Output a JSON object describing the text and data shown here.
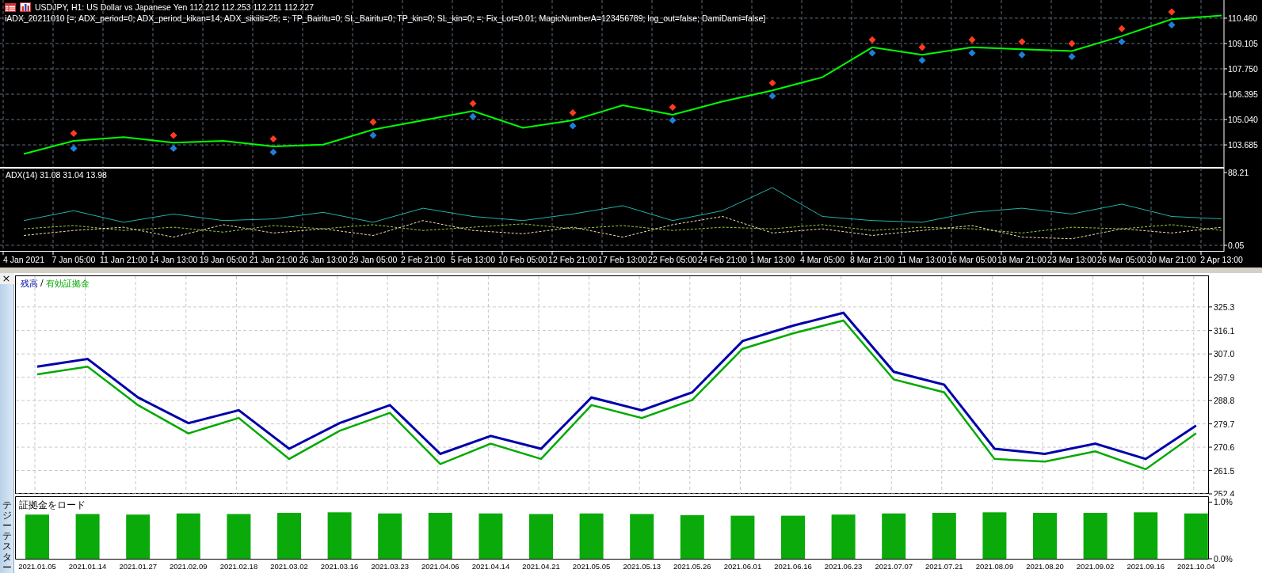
{
  "price_chart": {
    "symbol_line": "USDJPY, H1:  US Dollar vs Japanese Yen  112.212 112.253 112.211 112.227",
    "indicator_line": "iADX_20211010 [=; ADX_period=0; ADX_period_kikan=14; ADX_sikiiti=25; =; TP_Bairitu=0; SL_Bairitu=0; TP_kin=0; SL_kin=0; =; Fix_Lot=0.01; MagicNumberA=123456789; log_out=false; DamiDami=false]",
    "chart_data": {
      "type": "line",
      "grid": true,
      "categories": [
        null,
        null,
        null,
        null,
        null,
        null,
        null,
        null,
        null,
        null,
        null,
        null,
        null,
        null,
        null,
        null,
        null,
        null,
        null,
        null,
        null,
        null,
        null,
        null,
        null
      ],
      "series": [
        {
          "type": "line",
          "color": "#00ff00",
          "values": [
            103.2,
            103.9,
            104.1,
            103.8,
            103.9,
            103.6,
            103.7,
            104.5,
            105.0,
            105.5,
            104.6,
            105.0,
            105.8,
            105.3,
            106.0,
            106.6,
            107.3,
            108.9,
            108.5,
            108.9,
            108.8,
            108.7,
            109.5,
            110.4,
            110.6
          ]
        },
        {
          "type": "scatter",
          "color": "#ff3b1f",
          "values": [
            null,
            104.3,
            null,
            104.2,
            null,
            104.0,
            null,
            104.9,
            null,
            105.9,
            null,
            105.4,
            null,
            105.7,
            null,
            107.0,
            null,
            109.3,
            108.9,
            109.3,
            109.2,
            109.1,
            109.9,
            110.8,
            null
          ]
        },
        {
          "type": "scatter",
          "color": "#1e7fd8",
          "values": [
            null,
            103.5,
            null,
            103.5,
            null,
            103.3,
            null,
            104.2,
            null,
            105.2,
            null,
            104.7,
            null,
            105.0,
            null,
            106.3,
            null,
            108.6,
            108.2,
            108.6,
            108.5,
            108.4,
            109.2,
            110.1,
            null
          ]
        }
      ],
      "ylim": [
        102.46,
        111.43
      ],
      "yticks": [
        {
          "value": 110.46,
          "label": "110.460"
        },
        {
          "value": 109.105,
          "label": "109.105"
        },
        {
          "value": 107.75,
          "label": "107.750"
        },
        {
          "value": 106.395,
          "label": "106.395"
        },
        {
          "value": 105.04,
          "label": "105.040"
        },
        {
          "value": 103.685,
          "label": "103.685"
        }
      ]
    }
  },
  "adx_chart": {
    "label": "ADX(14) 31.08 31.04 13.98",
    "chart_data": {
      "type": "line",
      "grid": true,
      "categories": [
        "4 Jan 2021",
        "7 Jan 05:00",
        "11 Jan 21:00",
        "14 Jan 13:00",
        "19 Jan 05:00",
        "21 Jan 21:00",
        "26 Jan 13:00",
        "29 Jan 05:00",
        "2 Feb 21:00",
        "5 Feb 13:00",
        "10 Feb 05:00",
        "12 Feb 21:00",
        "17 Feb 13:00",
        "22 Feb 05:00",
        "24 Feb 21:00",
        "1 Mar 13:00",
        "4 Mar 05:00",
        "8 Mar 21:00",
        "11 Mar 13:00",
        "16 Mar 05:00",
        "18 Mar 21:00",
        "23 Mar 13:00",
        "26 Mar 05:00",
        "30 Mar 21:00",
        "2 Apr 13:00"
      ],
      "ylim": [
        0,
        88.21
      ],
      "yticks": [
        {
          "value": 88.21,
          "label": "88.21"
        },
        {
          "value": 0.05,
          "label": "0.05"
        }
      ],
      "series": [
        {
          "color": "#20b2aa",
          "line_style": "solid",
          "values": [
            30,
            42,
            28,
            38,
            30,
            32,
            40,
            28,
            45,
            35,
            30,
            38,
            48,
            30,
            42,
            70,
            35,
            30,
            28,
            40,
            45,
            38,
            50,
            35,
            32
          ]
        },
        {
          "color": "#9acd32",
          "line_style": "dashed",
          "values": [
            20,
            24,
            18,
            22,
            16,
            24,
            20,
            25,
            18,
            22,
            26,
            20,
            24,
            18,
            22,
            20,
            25,
            18,
            22,
            20,
            15,
            22,
            20,
            25,
            18
          ]
        },
        {
          "color": "#f5deb3",
          "line_style": "dashed",
          "values": [
            12,
            18,
            22,
            10,
            25,
            15,
            20,
            12,
            30,
            18,
            14,
            22,
            10,
            25,
            35,
            15,
            20,
            12,
            18,
            24,
            10,
            8,
            20,
            15,
            22
          ]
        }
      ]
    }
  },
  "tester": {
    "close_button": "×",
    "tab_label": "テジーテスター",
    "equity_chart": {
      "legend_separator": "/",
      "chart_data": {
        "type": "line",
        "grid": true,
        "categories": [
          null,
          null,
          null,
          null,
          null,
          null,
          null,
          null,
          null,
          null,
          null,
          null,
          null,
          null,
          null,
          null,
          null,
          null,
          null,
          null,
          null,
          null,
          null,
          null
        ],
        "series": [
          {
            "name": "残高",
            "color": "#0000aa",
            "values": [
              302,
              305,
              290,
              280,
              285,
              270,
              280,
              287,
              268,
              275,
              270,
              290,
              285,
              292,
              312,
              318,
              323,
              300,
              295,
              270,
              268,
              272,
              266,
              279
            ]
          },
          {
            "name": "有効証拠金",
            "color": "#00aa00",
            "values": [
              299,
              302,
              287,
              276,
              282,
              266,
              277,
              284,
              264,
              272,
              266,
              287,
              282,
              289,
              309,
              315,
              320,
              297,
              292,
              266,
              265,
              269,
              262,
              276
            ]
          }
        ],
        "ylim": [
          252.4,
          337.3
        ],
        "yticks": [
          {
            "value": 325.3,
            "label": "325.3"
          },
          {
            "value": 316.1,
            "label": "316.1"
          },
          {
            "value": 307.0,
            "label": "307.0"
          },
          {
            "value": 297.9,
            "label": "297.9"
          },
          {
            "value": 288.8,
            "label": "288.8"
          },
          {
            "value": 279.7,
            "label": "279.7"
          },
          {
            "value": 270.6,
            "label": "270.6"
          },
          {
            "value": 261.5,
            "label": "261.5"
          },
          {
            "value": 252.4,
            "label": "252.4"
          }
        ]
      }
    },
    "margin_chart": {
      "title": "証拠金をロード",
      "chart_data": {
        "type": "bar",
        "ylim": [
          0,
          1.09
        ],
        "yticks": [
          {
            "value": 1,
            "label": "1.0%"
          },
          {
            "value": 0,
            "label": "0.0%"
          }
        ],
        "categories": [
          "2021.01.05",
          "2021.01.14",
          "2021.01.27",
          "2021.02.09",
          "2021.02.18",
          "2021.03.02",
          "2021.03.16",
          "2021.03.23",
          "2021.04.06",
          "2021.04.14",
          "2021.04.21",
          "2021.05.05",
          "2021.05.13",
          "2021.05.26",
          "2021.06.01",
          "2021.06.16",
          "2021.06.23",
          "2021.07.07",
          "2021.07.21",
          "2021.08.09",
          "2021.08.20",
          "2021.09.02",
          "2021.09.16",
          "2021.10.04"
        ],
        "values": [
          0.78,
          0.79,
          0.78,
          0.8,
          0.79,
          0.81,
          0.82,
          0.8,
          0.81,
          0.8,
          0.79,
          0.8,
          0.79,
          0.77,
          0.76,
          0.76,
          0.78,
          0.8,
          0.81,
          0.82,
          0.81,
          0.81,
          0.82,
          0.8
        ]
      }
    }
  }
}
